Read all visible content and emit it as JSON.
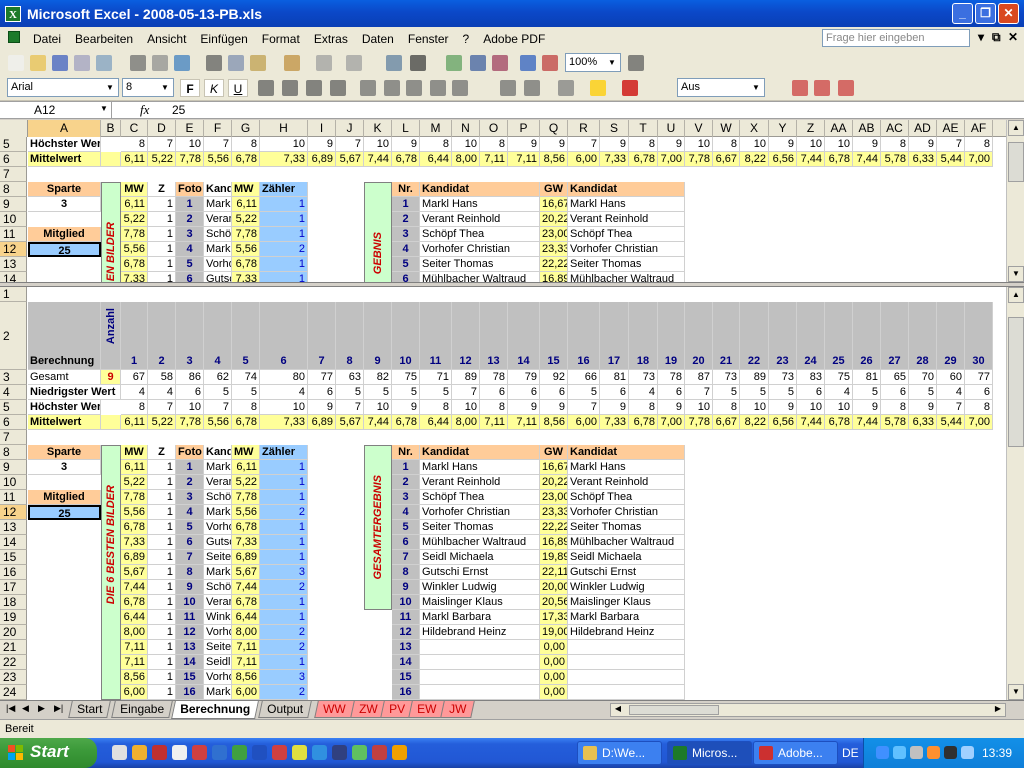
{
  "window": {
    "title": "Microsoft Excel - 2008-05-13-PB.xls",
    "icon_label": "X",
    "min": "_",
    "max": "❐",
    "close": "✕"
  },
  "menu": {
    "items": [
      "Datei",
      "Bearbeiten",
      "Ansicht",
      "Einfügen",
      "Format",
      "Extras",
      "Daten",
      "Fenster",
      "?",
      "Adobe PDF"
    ],
    "help_placeholder": "Frage hier eingeben"
  },
  "toolbar": {
    "zoom": "100%",
    "font": "Arial",
    "size": "8",
    "bold": "F",
    "italic": "K",
    "underline": "U",
    "zoom_arrow": "▼",
    "font_arrow": "▼",
    "size_arrow": "▼",
    "view": "Aus"
  },
  "formula": {
    "cell": "A12",
    "fx": "fx",
    "value": "25"
  },
  "columns": [
    "A",
    "B",
    "C",
    "D",
    "E",
    "F",
    "G",
    "H",
    "I",
    "J",
    "K",
    "L",
    "M",
    "N",
    "O",
    "P",
    "Q",
    "R",
    "S",
    "T",
    "U",
    "V",
    "W",
    "X",
    "Y",
    "Z",
    "AA",
    "AB",
    "AC",
    "AD",
    "AE",
    "AF",
    "A"
  ],
  "labels": {
    "hoechst": "Höchster Wert",
    "mittel": "Mittelwert",
    "sparte": "Sparte",
    "mitglied": "Mitglied",
    "berechnung": "Berechnung",
    "anzahl": "Anzahl",
    "gesamt": "Gesamt",
    "niedrig": "Niedrigster Wert",
    "mw": "MW",
    "z": "Z",
    "foto": "Foto",
    "kand": "Kand",
    "zaehler": "Zähler",
    "nr": "Nr.",
    "kandidat": "Kandidat",
    "gw": "GW",
    "besten": "DIE 6 BESTEN BILDER",
    "besten_top": "EN BILDER",
    "gesamtergebnis": "GESAMTERGEBNIS",
    "ergebnis_top": "GEBNIS"
  },
  "values": {
    "sparte": "3",
    "mitglied": "25"
  },
  "row_numbers_top": [
    "5",
    "6",
    "7",
    "8",
    "9",
    "10",
    "11",
    "12",
    "13",
    "14"
  ],
  "row_numbers_bottom": [
    "1",
    "2",
    "3",
    "4",
    "5",
    "6",
    "7",
    "8",
    "9",
    "10",
    "11",
    "12",
    "13",
    "14",
    "15",
    "16",
    "17",
    "18",
    "19",
    "20",
    "21",
    "22",
    "23",
    "24"
  ],
  "stats": {
    "anzahl": "9",
    "col_nums": [
      "1",
      "2",
      "3",
      "4",
      "5",
      "6",
      "7",
      "8",
      "9",
      "10",
      "11",
      "12",
      "13",
      "14",
      "15",
      "16",
      "17",
      "18",
      "19",
      "20",
      "21",
      "22",
      "23",
      "24",
      "25",
      "26",
      "27",
      "28",
      "29",
      "30",
      "3"
    ],
    "gesamt": [
      "67",
      "58",
      "86",
      "62",
      "74",
      "80",
      "77",
      "63",
      "82",
      "75",
      "71",
      "89",
      "78",
      "79",
      "92",
      "66",
      "81",
      "73",
      "78",
      "87",
      "73",
      "89",
      "73",
      "83",
      "75",
      "81",
      "65",
      "70",
      "60",
      "77",
      ""
    ],
    "niedrig": [
      "4",
      "4",
      "6",
      "5",
      "5",
      "4",
      "6",
      "5",
      "5",
      "5",
      "5",
      "7",
      "6",
      "6",
      "6",
      "5",
      "6",
      "4",
      "6",
      "7",
      "5",
      "5",
      "5",
      "6",
      "4",
      "5",
      "6",
      "5",
      "4",
      "6",
      ""
    ],
    "hoechst": [
      "8",
      "7",
      "10",
      "7",
      "8",
      "10",
      "9",
      "7",
      "10",
      "9",
      "8",
      "10",
      "8",
      "9",
      "9",
      "7",
      "9",
      "8",
      "9",
      "10",
      "8",
      "10",
      "9",
      "10",
      "10",
      "9",
      "8",
      "9",
      "7",
      "8",
      ""
    ],
    "mittel": [
      "6,11",
      "5,22",
      "7,78",
      "5,56",
      "6,78",
      "7,33",
      "6,89",
      "5,67",
      "7,44",
      "6,78",
      "6,44",
      "8,00",
      "7,11",
      "7,11",
      "8,56",
      "6,00",
      "7,33",
      "6,78",
      "7,00",
      "7,78",
      "6,67",
      "8,22",
      "6,56",
      "7,44",
      "6,78",
      "7,44",
      "5,78",
      "6,33",
      "5,44",
      "7,00",
      "6,"
    ]
  },
  "best": [
    {
      "mw": "6,11",
      "z": "1",
      "foto": "1",
      "kand": "Markl",
      "mw2": "6,11",
      "zaehler": "1"
    },
    {
      "mw": "5,22",
      "z": "1",
      "foto": "2",
      "kand": "Veran",
      "mw2": "5,22",
      "zaehler": "1"
    },
    {
      "mw": "7,78",
      "z": "1",
      "foto": "3",
      "kand": "Schöp",
      "mw2": "7,78",
      "zaehler": "1"
    },
    {
      "mw": "5,56",
      "z": "1",
      "foto": "4",
      "kand": "Markl",
      "mw2": "5,56",
      "zaehler": "2"
    },
    {
      "mw": "6,78",
      "z": "1",
      "foto": "5",
      "kand": "Vorho",
      "mw2": "6,78",
      "zaehler": "1"
    },
    {
      "mw": "7,33",
      "z": "1",
      "foto": "6",
      "kand": "Gutsc",
      "mw2": "7,33",
      "zaehler": "1"
    },
    {
      "mw": "6,89",
      "z": "1",
      "foto": "7",
      "kand": "Seiter",
      "mw2": "6,89",
      "zaehler": "1"
    },
    {
      "mw": "5,67",
      "z": "1",
      "foto": "8",
      "kand": "Markl",
      "mw2": "5,67",
      "zaehler": "3"
    },
    {
      "mw": "7,44",
      "z": "1",
      "foto": "9",
      "kand": "Schöp",
      "mw2": "7,44",
      "zaehler": "2"
    },
    {
      "mw": "6,78",
      "z": "1",
      "foto": "10",
      "kand": "Veran",
      "mw2": "6,78",
      "zaehler": "1"
    },
    {
      "mw": "6,44",
      "z": "1",
      "foto": "11",
      "kand": "Winkl",
      "mw2": "6,44",
      "zaehler": "1"
    },
    {
      "mw": "8,00",
      "z": "1",
      "foto": "12",
      "kand": "Vorho",
      "mw2": "8,00",
      "zaehler": "2"
    },
    {
      "mw": "7,11",
      "z": "1",
      "foto": "13",
      "kand": "Seiter",
      "mw2": "7,11",
      "zaehler": "2"
    },
    {
      "mw": "7,11",
      "z": "1",
      "foto": "14",
      "kand": "Seidl",
      "mw2": "7,11",
      "zaehler": "1"
    },
    {
      "mw": "8,56",
      "z": "1",
      "foto": "15",
      "kand": "Vorho",
      "mw2": "8,56",
      "zaehler": "3"
    },
    {
      "mw": "6,00",
      "z": "1",
      "foto": "16",
      "kand": "Markl",
      "mw2": "6,00",
      "zaehler": "2"
    }
  ],
  "results": [
    {
      "nr": "1",
      "kandidat": "Markl Hans",
      "gw": "16,67",
      "kandidat2": "Markl Hans"
    },
    {
      "nr": "2",
      "kandidat": "Verant Reinhold",
      "gw": "20,22",
      "kandidat2": "Verant Reinhold"
    },
    {
      "nr": "3",
      "kandidat": "Schöpf Thea",
      "gw": "23,00",
      "kandidat2": "Schöpf Thea"
    },
    {
      "nr": "4",
      "kandidat": "Vorhofer Christian",
      "gw": "23,33",
      "kandidat2": "Vorhofer Christian"
    },
    {
      "nr": "5",
      "kandidat": "Seiter Thomas",
      "gw": "22,22",
      "kandidat2": "Seiter Thomas"
    },
    {
      "nr": "6",
      "kandidat": "Mühlbacher Waltraud",
      "gw": "16,89",
      "kandidat2": "Mühlbacher Waltraud"
    },
    {
      "nr": "7",
      "kandidat": "Seidl Michaela",
      "gw": "19,89",
      "kandidat2": "Seidl Michaela"
    },
    {
      "nr": "8",
      "kandidat": "Gutschi Ernst",
      "gw": "22,11",
      "kandidat2": "Gutschi Ernst"
    },
    {
      "nr": "9",
      "kandidat": "Winkler Ludwig",
      "gw": "20,00",
      "kandidat2": "Winkler Ludwig"
    },
    {
      "nr": "10",
      "kandidat": "Maislinger Klaus",
      "gw": "20,56",
      "kandidat2": "Maislinger Klaus"
    },
    {
      "nr": "11",
      "kandidat": "Markl Barbara",
      "gw": "17,33",
      "kandidat2": "Markl Barbara"
    },
    {
      "nr": "12",
      "kandidat": "Hildebrand Heinz",
      "gw": "19,00",
      "kandidat2": "Hildebrand Heinz"
    },
    {
      "nr": "13",
      "kandidat": "",
      "gw": "0,00",
      "kandidat2": ""
    },
    {
      "nr": "14",
      "kandidat": "",
      "gw": "0,00",
      "kandidat2": ""
    },
    {
      "nr": "15",
      "kandidat": "",
      "gw": "0,00",
      "kandidat2": ""
    },
    {
      "nr": "16",
      "kandidat": "",
      "gw": "0,00",
      "kandidat2": ""
    }
  ],
  "tabs": [
    "Start",
    "Eingabe",
    "Berechnung",
    "Output",
    "WW",
    "ZW",
    "PV",
    "EW",
    "JW"
  ],
  "tab_nav": [
    "|◀",
    "◀",
    "▶",
    "▶|"
  ],
  "status": "Bereit",
  "taskbar": {
    "start": "Start",
    "items": [
      "D:\\We...",
      "Micros...",
      "Adobe..."
    ],
    "lang": "DE",
    "clock": "13:39"
  },
  "colors": {
    "yellow": "#ffff99",
    "blue": "#99ccff",
    "orange": "#ffcc99",
    "green": "#ccffcc",
    "selected": "#f8d38c"
  }
}
